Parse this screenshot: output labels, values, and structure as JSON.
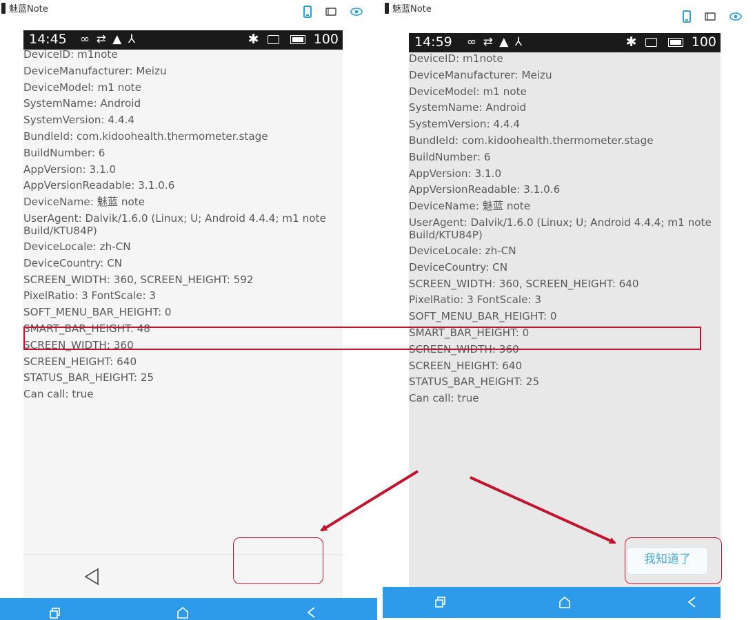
{
  "left": {
    "window_title": "魅蓝Note",
    "toolbar_icons": [
      "phone-icon",
      "tablet-icon",
      "eye-icon"
    ],
    "status_bar": {
      "time": "14:45",
      "battery": "100",
      "icons": [
        "infinity-icon",
        "usb-icon",
        "warning-icon",
        "branch-icon",
        "bluetooth-icon",
        "screen-icon",
        "battery-icon"
      ]
    },
    "info_lines": [
      "DeviceID: m1note",
      "DeviceManufacturer: Meizu",
      "DeviceModel: m1 note",
      "SystemName: Android",
      "SystemVersion: 4.4.4",
      "BundleId: com.kidoohealth.thermometer.stage",
      "BuildNumber: 6",
      "AppVersion: 3.1.0",
      "AppVersionReadable: 3.1.0.6",
      "DeviceName: 魅蓝 note",
      "UserAgent: Dalvik/1.6.0 (Linux; U; Android 4.4.4; m1 note Build/KTU84P)",
      "DeviceLocale: zh-CN",
      "DeviceCountry: CN",
      "SCREEN_WIDTH: 360, SCREEN_HEIGHT: 592",
      "PixelRatio: 3 FontScale: 3",
      "SOFT_MENU_BAR_HEIGHT: 0",
      "SMART_BAR_HEIGHT: 48",
      "SCREEN_WIDTH: 360",
      "SCREEN_HEIGHT: 640",
      "STATUS_BAR_HEIGHT: 25",
      "Can call: true"
    ],
    "soft_nav": [
      "back-triangle-icon"
    ],
    "bottom_nav": [
      "recent-apps-icon",
      "home-icon",
      "back-icon"
    ]
  },
  "right": {
    "window_title": "魅蓝Note",
    "toolbar_icons": [
      "phone-icon",
      "tablet-icon",
      "eye-icon"
    ],
    "status_bar": {
      "time": "14:59",
      "battery": "100",
      "icons": [
        "infinity-icon",
        "usb-icon",
        "warning-icon",
        "branch-icon",
        "bluetooth-icon",
        "screen-icon",
        "battery-icon"
      ]
    },
    "info_lines": [
      "DeviceID: m1note",
      "DeviceManufacturer: Meizu",
      "DeviceModel: m1 note",
      "SystemName: Android",
      "SystemVersion: 4.4.4",
      "BundleId: com.kidoohealth.thermometer.stage",
      "BuildNumber: 6",
      "AppVersion: 3.1.0",
      "AppVersionReadable: 3.1.0.6",
      "DeviceName: 魅蓝 note",
      "UserAgent: Dalvik/1.6.0 (Linux; U; Android 4.4.4; m1 note Build/KTU84P)",
      "DeviceLocale: zh-CN",
      "DeviceCountry: CN",
      "SCREEN_WIDTH: 360, SCREEN_HEIGHT: 640",
      "PixelRatio: 3 FontScale: 3",
      "SOFT_MENU_BAR_HEIGHT: 0",
      "SMART_BAR_HEIGHT: 0",
      "SCREEN_WIDTH: 360",
      "SCREEN_HEIGHT: 640",
      "STATUS_BAR_HEIGHT: 25",
      "Can call: true"
    ],
    "got_it_button": "我知道了",
    "bottom_nav": [
      "recent-apps-icon",
      "home-icon",
      "back-icon"
    ]
  },
  "colors": {
    "annotation": "#c0152e",
    "nav_bar": "#2d9bea",
    "toolbar_icon": "#2aa0d8",
    "status_bar": "#1a1a1a",
    "text": "#5a5a5a"
  }
}
